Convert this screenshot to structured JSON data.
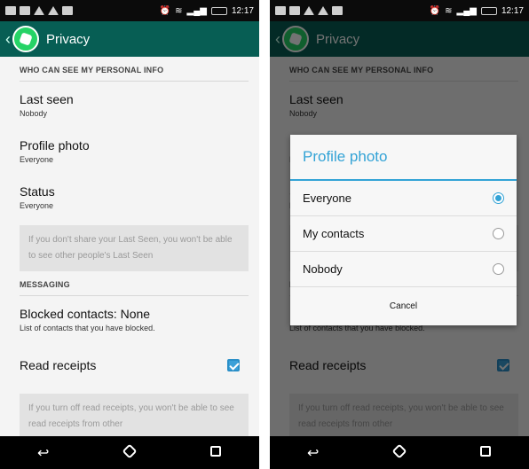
{
  "status_bar": {
    "time": "12:17"
  },
  "app_bar": {
    "title": "Privacy"
  },
  "sections": {
    "personal": "WHO CAN SEE MY PERSONAL INFO",
    "messaging": "MESSAGING"
  },
  "prefs": {
    "last_seen": {
      "title": "Last seen",
      "value": "Nobody"
    },
    "profile_photo": {
      "title": "Profile photo",
      "value": "Everyone"
    },
    "status": {
      "title": "Status",
      "value": "Everyone"
    },
    "blocked": {
      "title": "Blocked contacts: None",
      "subtitle": "List of contacts that you have blocked."
    },
    "read_receipts": {
      "title": "Read receipts",
      "checked": true
    }
  },
  "notes": {
    "last_seen": "If you don't share your Last Seen, you won't be able to see other people's Last Seen",
    "read_receipts": "If you turn off read receipts, you won't be able to see read receipts from other"
  },
  "dialog": {
    "title": "Profile photo",
    "options": [
      {
        "label": "Everyone",
        "selected": true
      },
      {
        "label": "My contacts",
        "selected": false
      },
      {
        "label": "Nobody",
        "selected": false
      }
    ],
    "cancel": "Cancel"
  },
  "navbar": {
    "back": "back-icon",
    "home": "home-icon",
    "recents": "recents-icon"
  },
  "colors": {
    "app_bar": "#075e54",
    "accent": "#33a3d6",
    "checkbox": "#3ba0d8"
  }
}
